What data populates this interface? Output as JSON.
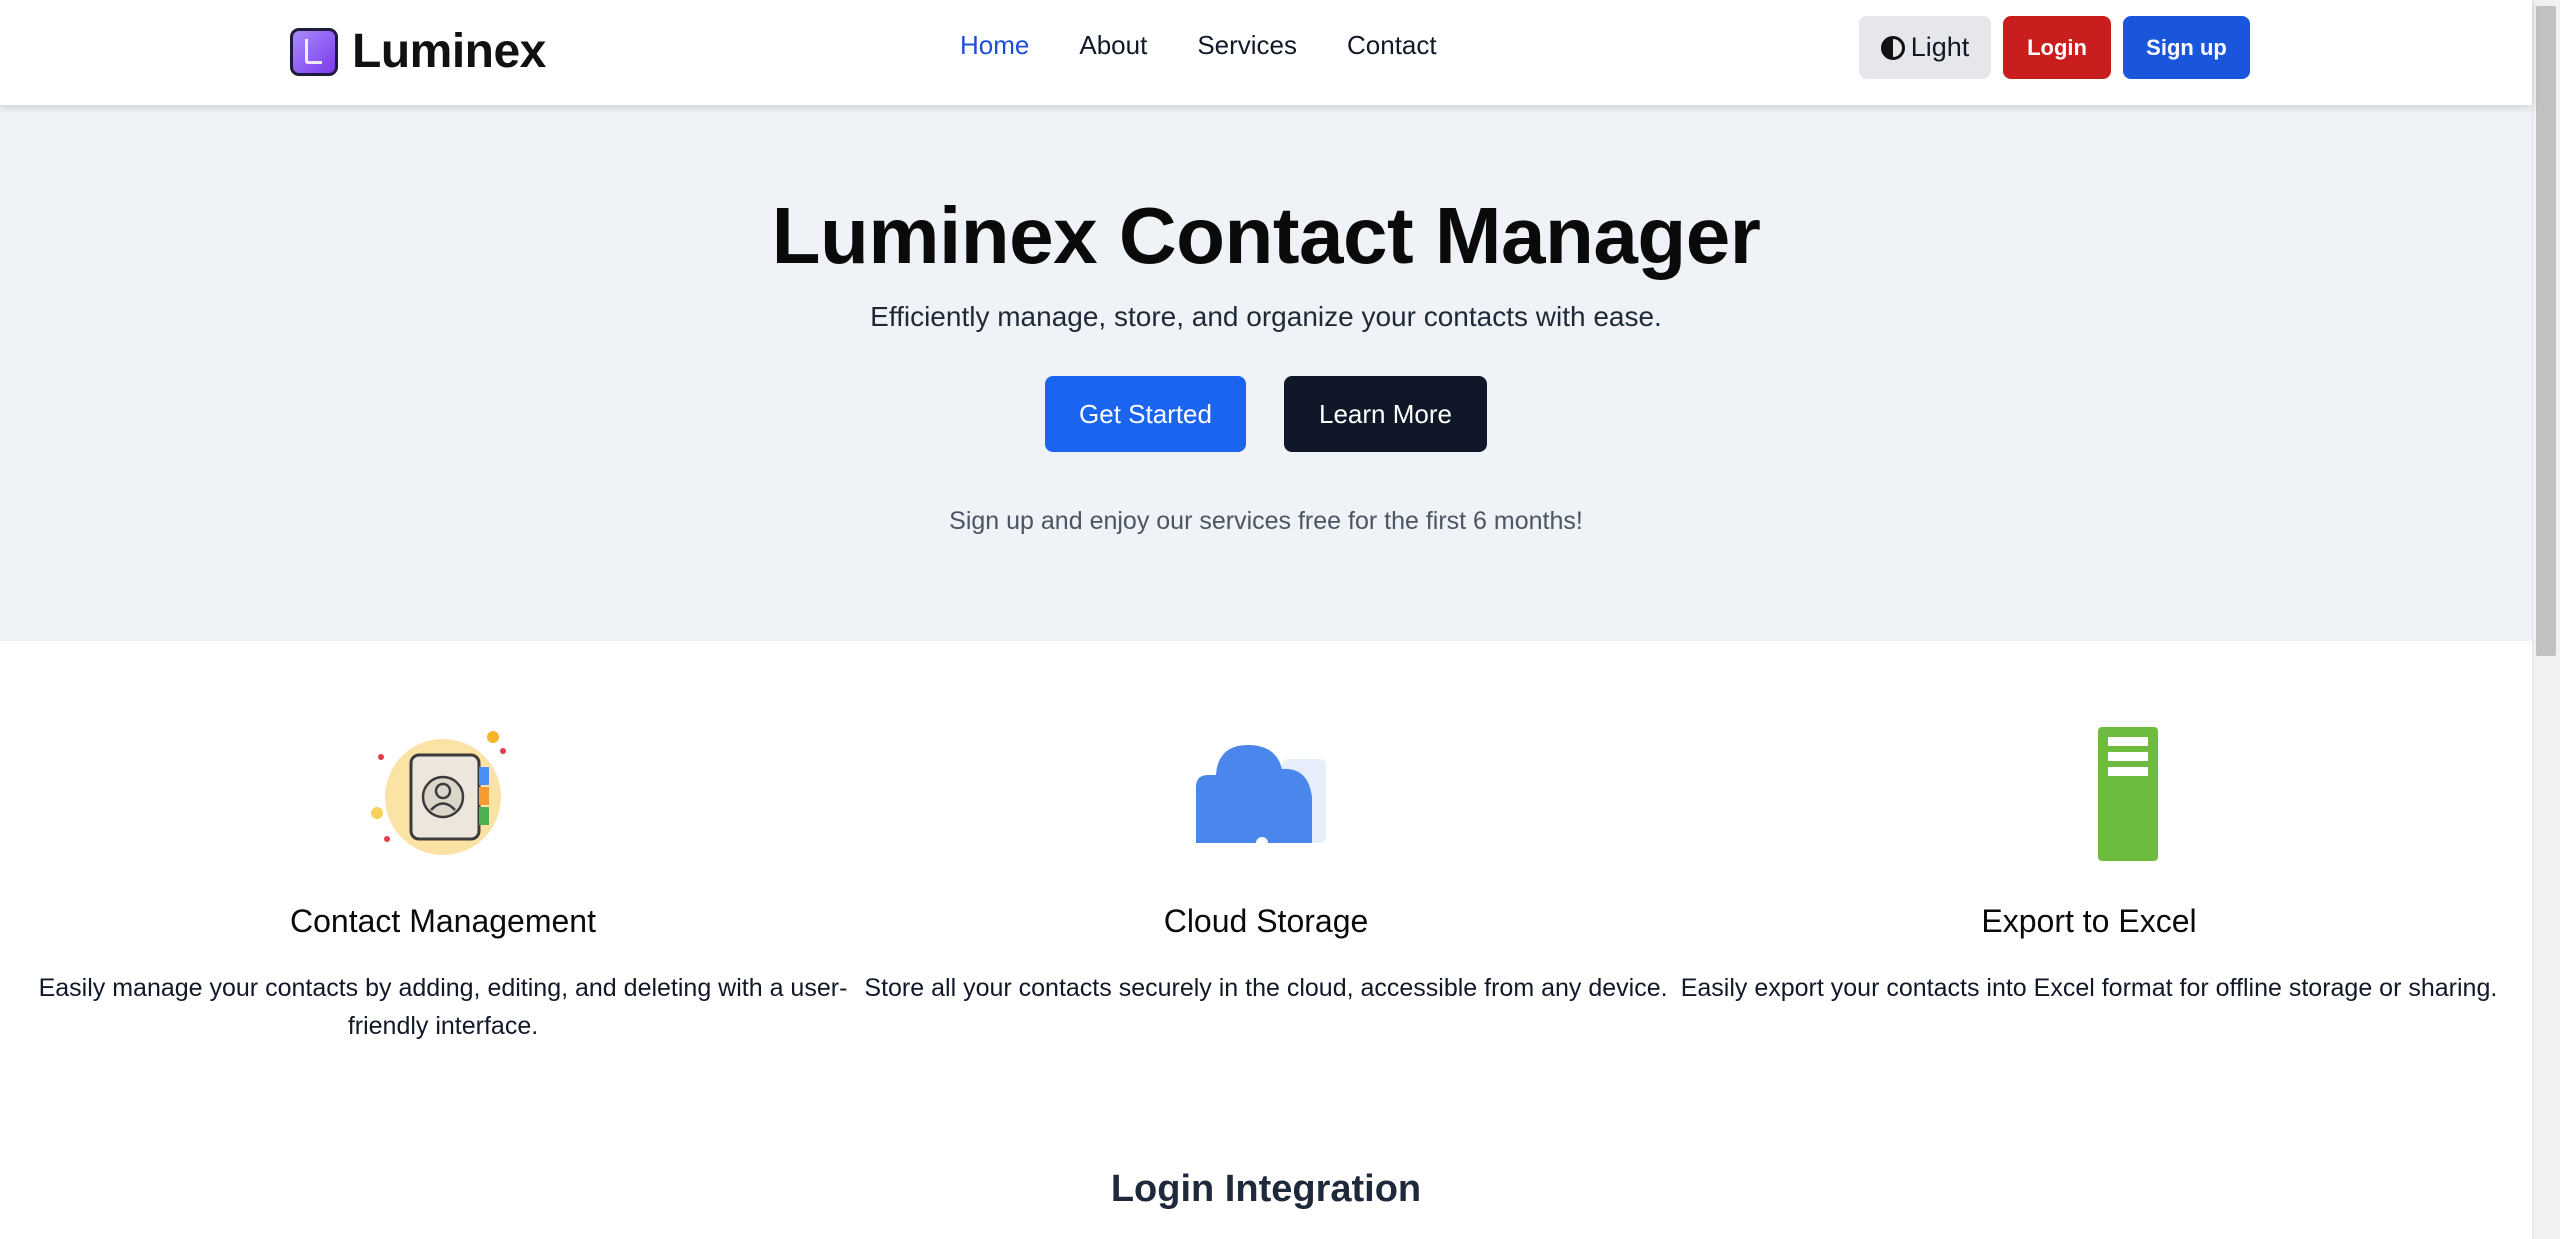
{
  "brand": {
    "name": "Luminex",
    "logo_icon": "book-logo-icon",
    "accent": "#7c3aed"
  },
  "nav": {
    "links": [
      {
        "label": "Home",
        "active": true
      },
      {
        "label": "About",
        "active": false
      },
      {
        "label": "Services",
        "active": false
      },
      {
        "label": "Contact",
        "active": false
      }
    ],
    "theme_toggle": {
      "label": "Light",
      "icon": "contrast-half-circle-icon"
    },
    "login_label": "Login",
    "signup_label": "Sign up"
  },
  "hero": {
    "title": "Luminex Contact Manager",
    "subtitle": "Efficiently manage, store, and organize your contacts with ease.",
    "primary_cta": "Get Started",
    "secondary_cta": "Learn More",
    "note": "Sign up and enjoy our services free for the first 6 months!"
  },
  "features": [
    {
      "icon": "address-book-icon",
      "title": "Contact Management",
      "description": "Easily manage your contacts by adding, editing, and deleting with a user-friendly interface."
    },
    {
      "icon": "cloud-storage-icon",
      "title": "Cloud Storage",
      "description": "Store all your contacts securely in the cloud, accessible from any device."
    },
    {
      "icon": "excel-export-icon",
      "title": "Export to Excel",
      "description": "Easily export your contacts into Excel format for offline storage or sharing."
    }
  ],
  "next_section": {
    "title": "Login Integration"
  },
  "colors": {
    "primary": "#1a64f0",
    "danger": "#c81e1e",
    "signup": "#1a56db",
    "dark": "#0f1729",
    "active_link": "#1d4ed8",
    "hero_bg": "#eff2f7"
  }
}
